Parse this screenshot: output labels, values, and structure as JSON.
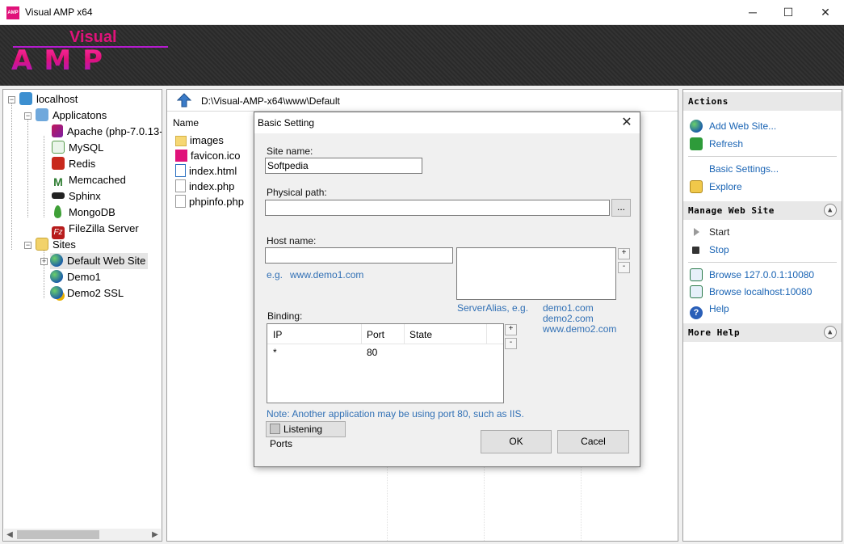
{
  "window": {
    "title": "Visual AMP x64",
    "app_icon_text": "AMP",
    "minimize_glyph": "─",
    "maximize_glyph": "☐",
    "close_glyph": "✕"
  },
  "logo": {
    "top": "Visual",
    "bottom": "AMP"
  },
  "tree": {
    "root": "localhost",
    "applications_label": "Applicatons",
    "applications": [
      {
        "label": "Apache (php-7.0.13-",
        "icon": "apache-feather-icon"
      },
      {
        "label": "MySQL",
        "icon": "mysql-dolphin-icon"
      },
      {
        "label": "Redis",
        "icon": "redis-cube-icon"
      },
      {
        "label": "Memcached",
        "icon": "memcached-m-icon"
      },
      {
        "label": "Sphinx",
        "icon": "sphinx-icon"
      },
      {
        "label": "MongoDB",
        "icon": "mongodb-leaf-icon"
      },
      {
        "label": "FileZilla Server",
        "icon": "filezilla-icon"
      }
    ],
    "sites_label": "Sites",
    "sites": [
      {
        "label": "Default Web Site"
      },
      {
        "label": "Demo1"
      },
      {
        "label": "Demo2 SSL"
      }
    ]
  },
  "center": {
    "path": "D:\\Visual-AMP-x64\\www\\Default",
    "column_name": "Name",
    "files": [
      {
        "name": "images",
        "icon": "folder-icon"
      },
      {
        "name": "favicon.ico",
        "icon": "amp-favicon-icon"
      },
      {
        "name": "index.html",
        "icon": "html-file-icon"
      },
      {
        "name": "index.php",
        "icon": "file-icon"
      },
      {
        "name": "phpinfo.php",
        "icon": "file-icon"
      }
    ]
  },
  "actions": {
    "header": "Actions",
    "items": [
      {
        "label": "Add Web Site...",
        "icon": "globe-add-icon"
      },
      {
        "label": "Refresh",
        "icon": "refresh-icon"
      },
      {
        "label": "Basic Settings..."
      },
      {
        "label": "Explore",
        "icon": "explore-icon"
      }
    ],
    "manage_header": "Manage Web Site",
    "manage_items": [
      {
        "label": "Start",
        "icon": "play-icon"
      },
      {
        "label": "Stop",
        "icon": "stop-icon"
      },
      {
        "label": "Browse 127.0.0.1:10080",
        "icon": "browse-icon"
      },
      {
        "label": "Browse localhost:10080",
        "icon": "browse-icon"
      },
      {
        "label": "Help",
        "icon": "help-icon"
      }
    ],
    "more_help_header": "More Help"
  },
  "dialog": {
    "title": "Basic Setting",
    "site_name_label": "Site name:",
    "site_name_value": "Softpedia",
    "physical_path_label": "Physical path:",
    "physical_path_value": "",
    "browse_button": "...",
    "host_name_label": "Host name:",
    "host_name_value": "",
    "host_example_prefix": "e.g.",
    "host_example": "www.demo1.com",
    "alias_example_label": "ServerAlias, e.g.",
    "alias_examples": [
      "demo1.com",
      "demo2.com",
      "www.demo2.com"
    ],
    "binding_label": "Binding:",
    "binding_columns": [
      "IP",
      "Port",
      "State"
    ],
    "binding_rows": [
      {
        "ip": "*",
        "port": "80",
        "state": ""
      }
    ],
    "add_glyph": "+",
    "remove_glyph": "-",
    "note": "Note: Another application may be using port 80, such as IIS.",
    "listening_ports_button": "Listening Ports",
    "ok_button": "OK",
    "cancel_button": "Cacel"
  }
}
